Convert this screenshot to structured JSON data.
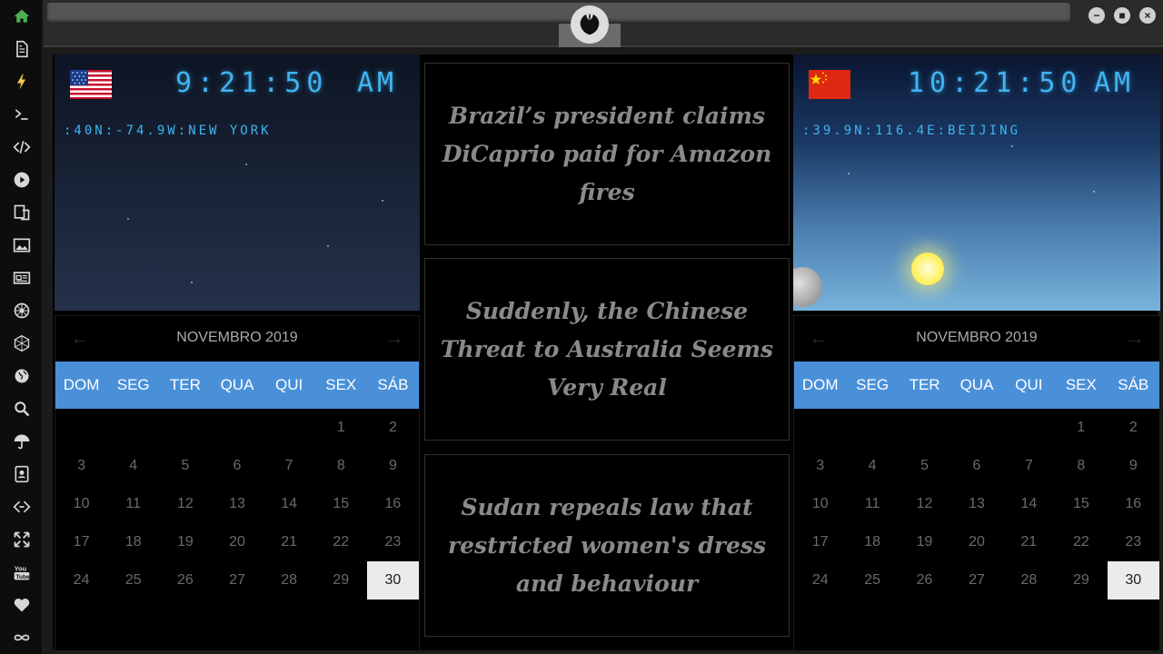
{
  "sidebar": {
    "items": [
      {
        "icon": "home-icon"
      },
      {
        "icon": "document-icon"
      },
      {
        "icon": "lightning-icon"
      },
      {
        "icon": "terminal-icon"
      },
      {
        "icon": "code-icon"
      },
      {
        "icon": "play-icon"
      },
      {
        "icon": "translate-icon"
      },
      {
        "icon": "image-icon"
      },
      {
        "icon": "newspaper-icon"
      },
      {
        "icon": "empire-icon"
      },
      {
        "icon": "hexagon-icon"
      },
      {
        "icon": "globe-icon"
      },
      {
        "icon": "search-icon"
      },
      {
        "icon": "umbrella-icon"
      },
      {
        "icon": "contacts-icon"
      },
      {
        "icon": "network-icon"
      },
      {
        "icon": "expand-icon"
      },
      {
        "icon": "youtube-icon"
      },
      {
        "icon": "heart-icon"
      },
      {
        "icon": "infinity-icon"
      }
    ],
    "active_color": "#4caf50",
    "accent_color": "#f2c94c"
  },
  "window": {
    "logo_icon": "rebel-alliance-icon",
    "minimize": "−",
    "maximize": "■",
    "close": "×"
  },
  "clock_ny": {
    "flag_icon": "us-flag-icon",
    "time": "9:21:50",
    "ampm": "AM",
    "coords": ":40N:-74.9W:NEW YORK"
  },
  "clock_bj": {
    "flag_icon": "cn-flag-icon",
    "time": "10:21:50",
    "ampm": "AM",
    "coords": ":39.9N:116.4E:BEIJING",
    "sun_icon": "sun-icon",
    "moon_icon": "moon-icon"
  },
  "calendar": {
    "title": "NOVEMBRO 2019",
    "prev": "←",
    "next": "→",
    "weekdays": [
      "DOM",
      "SEG",
      "TER",
      "QUA",
      "QUI",
      "SEX",
      "SÁB"
    ],
    "first_weekday_index": 5,
    "days_in_month": 30,
    "today": 30,
    "header_color": "#4a90d9"
  },
  "news": [
    {
      "headline": "Brazil’s president claims DiCaprio paid for Amazon fires"
    },
    {
      "headline": "Suddenly, the Chinese Threat to Australia Seems Very Real"
    },
    {
      "headline": "Sudan repeals law that restricted women's dress and behaviour"
    }
  ]
}
